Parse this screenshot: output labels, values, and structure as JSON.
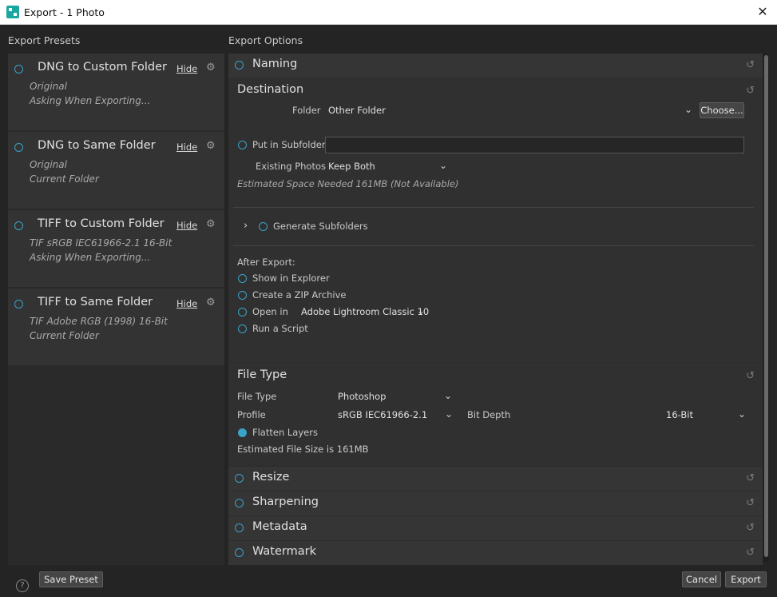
{
  "window": {
    "title": "Export - 1 Photo",
    "close_icon": "close-icon"
  },
  "left": {
    "heading": "Export Presets",
    "presets": [
      {
        "name": "DNG to Custom Folder",
        "hide": "Hide",
        "line1": "Original",
        "line2": "Asking When Exporting..."
      },
      {
        "name": "DNG to Same Folder",
        "hide": "Hide",
        "line1": "Original",
        "line2": "Current Folder"
      },
      {
        "name": "TIFF to Custom Folder",
        "hide": "Hide",
        "line1": "TIF  sRGB IEC61966-2.1  16-Bit",
        "line2": "Asking When Exporting..."
      },
      {
        "name": "TIFF to Same Folder",
        "hide": "Hide",
        "line1": "TIF  Adobe RGB (1998)  16-Bit",
        "line2": "Current Folder"
      }
    ]
  },
  "right": {
    "heading": "Export Options",
    "naming": {
      "title": "Naming"
    },
    "destination": {
      "title": "Destination",
      "folder_label": "Folder",
      "folder_value": "Other Folder",
      "choose_button": "Choose...",
      "subfolder_label": "Put in Subfolder",
      "subfolder_value": "",
      "existing_label": "Existing Photos",
      "existing_value": "Keep Both",
      "space_note": "Estimated Space Needed 161MB (Not Available)",
      "generate_subfolders": "Generate Subfolders",
      "after_export_label": "After Export:",
      "show_in_explorer": "Show in Explorer",
      "create_zip": "Create a ZIP Archive",
      "open_in": "Open in",
      "open_in_value": "Adobe Lightroom Classic 10",
      "run_script": "Run a Script"
    },
    "file_type": {
      "title": "File Type",
      "type_label": "File Type",
      "type_value": "Photoshop",
      "profile_label": "Profile",
      "profile_value": "sRGB IEC61966-2.1",
      "bit_depth_label": "Bit Depth",
      "bit_depth_value": "16-Bit",
      "flatten_label": "Flatten Layers",
      "size_note": "Estimated File Size is 161MB"
    },
    "resize": {
      "title": "Resize"
    },
    "sharpening": {
      "title": "Sharpening"
    },
    "metadata": {
      "title": "Metadata"
    },
    "watermark": {
      "title": "Watermark"
    }
  },
  "footer": {
    "help": "?",
    "save_preset": "Save Preset",
    "cancel": "Cancel",
    "export": "Export"
  },
  "colors": {
    "accent": "#3aa2c8",
    "background": "#242424",
    "panel": "#2e2e2e"
  }
}
